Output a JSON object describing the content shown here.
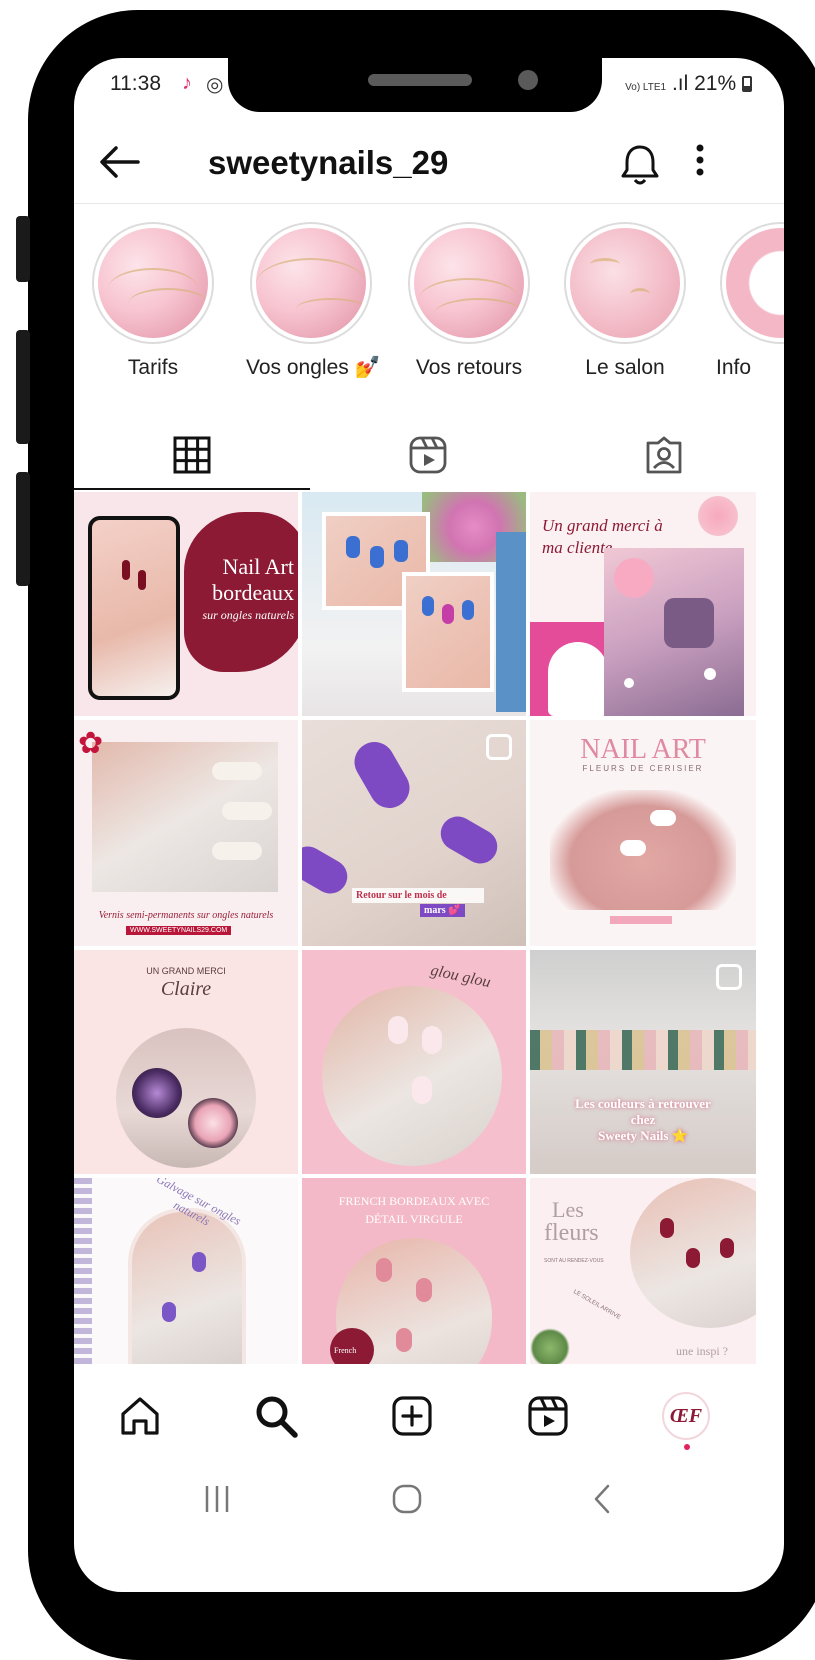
{
  "status_bar": {
    "time": "11:38",
    "network": "Vo) LTE1",
    "signal": ".ıl",
    "battery": "21%"
  },
  "profile": {
    "username": "sweetynails_29"
  },
  "highlights": [
    {
      "label": "Tarifs"
    },
    {
      "label": "Vos ongles 💅"
    },
    {
      "label": "Vos retours"
    },
    {
      "label": "Le salon"
    },
    {
      "label": "Info"
    }
  ],
  "tabs": [
    {
      "icon": "grid-icon",
      "active": true
    },
    {
      "icon": "reels-icon",
      "active": false
    },
    {
      "icon": "tagged-icon",
      "active": false
    }
  ],
  "posts": [
    {
      "line1": "Nail Art",
      "line2": "bordeaux",
      "line3": "sur ongles naturels"
    },
    {},
    {
      "line1": "Un grand merci à",
      "line2": "ma cliente"
    },
    {
      "line1": "Vernis semi-permanents sur ongles naturels",
      "line2": "WWW.SWEETYNAILS29.COM"
    },
    {
      "line1": "Retour sur le mois de",
      "line2": "mars 💕"
    },
    {
      "line1": "NAIL ART",
      "line2": "FLEURS DE CERISIER"
    },
    {
      "line1": "UN GRAND MERCI",
      "line2": "Claire"
    },
    {
      "line1": "glou glou"
    },
    {
      "line1": "Les couleurs à retrouver",
      "line2": "chez",
      "line3": "Sweety Nails ⭐"
    },
    {
      "line1": "Galvage sur ongles naturels"
    },
    {
      "line1": "FRENCH BORDEAUX AVEC",
      "line2": "DÉTAIL VIRGULE",
      "line3": "French"
    },
    {
      "line1": "Les",
      "line2": "fleurs",
      "line3": "SONT AU RENDEZ-VOUS",
      "line4": "LE SOLEIL ARRIVE",
      "line5": "une inspi ?"
    }
  ],
  "avatar_text": "ŒF",
  "colors": {
    "accent": "#e0245e",
    "bordeaux": "#8c1a34",
    "pink": "#f4b7c6",
    "light_pink": "#fbe3e8",
    "dark": "#111111"
  }
}
